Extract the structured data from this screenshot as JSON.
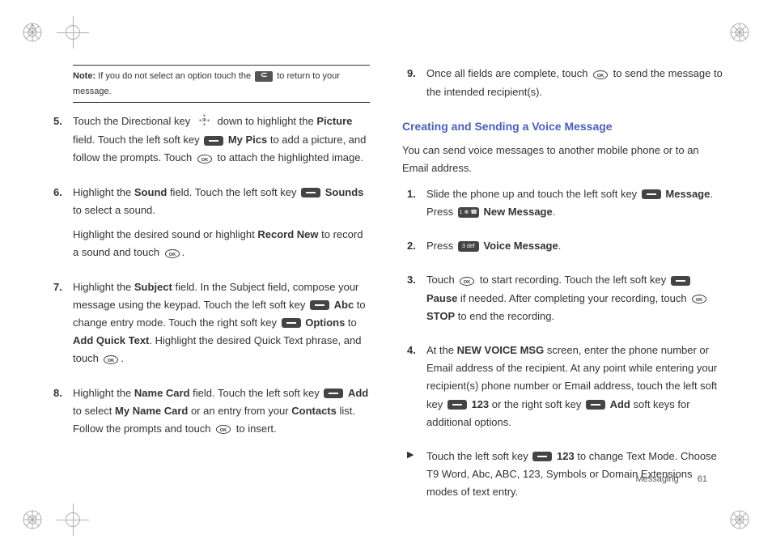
{
  "note": {
    "label": "Note:",
    "text_before": " If you do not select an option touch the ",
    "text_after": " to return to your message."
  },
  "left_steps": [
    {
      "num": "5.",
      "paragraphs": [
        {
          "fragments": [
            {
              "t": "Touch the Directional key "
            },
            {
              "icon": "dirkey"
            },
            {
              "t": " down to highlight the "
            },
            {
              "b": "Picture"
            },
            {
              "t": " field. Touch the left soft key "
            },
            {
              "icon": "softkey"
            },
            {
              "t": " "
            },
            {
              "b": "My Pics"
            },
            {
              "t": " to add a picture, and follow the prompts. Touch "
            },
            {
              "icon": "ok"
            },
            {
              "t": " to attach the highlighted image."
            }
          ]
        }
      ]
    },
    {
      "num": "6.",
      "paragraphs": [
        {
          "fragments": [
            {
              "t": "Highlight the "
            },
            {
              "b": "Sound"
            },
            {
              "t": " field. Touch the left soft key "
            },
            {
              "icon": "softkey"
            },
            {
              "t": " "
            },
            {
              "b": "Sounds"
            },
            {
              "t": " to select a sound."
            }
          ]
        },
        {
          "fragments": [
            {
              "t": "Highlight the desired sound or highlight "
            },
            {
              "b": "Record New"
            },
            {
              "t": " to record a sound and touch "
            },
            {
              "icon": "ok"
            },
            {
              "t": "."
            }
          ]
        }
      ]
    },
    {
      "num": "7.",
      "paragraphs": [
        {
          "fragments": [
            {
              "t": "Highlight the "
            },
            {
              "b": "Subject"
            },
            {
              "t": " field. In the Subject field, compose your message using the keypad. Touch the left soft key "
            },
            {
              "icon": "softkey"
            },
            {
              "t": " "
            },
            {
              "b": "Abc"
            },
            {
              "t": " to change entry mode. Touch the right soft key "
            },
            {
              "icon": "softkey"
            },
            {
              "t": " "
            },
            {
              "b": "Options"
            },
            {
              "t": " to "
            },
            {
              "b": "Add Quick Text"
            },
            {
              "t": ". Highlight the desired Quick Text phrase, and touch "
            },
            {
              "icon": "ok"
            },
            {
              "t": "."
            }
          ]
        }
      ]
    },
    {
      "num": "8.",
      "paragraphs": [
        {
          "fragments": [
            {
              "t": "Highlight the "
            },
            {
              "b": "Name Card"
            },
            {
              "t": " field. Touch the left soft key "
            },
            {
              "icon": "softkey"
            },
            {
              "t": " "
            },
            {
              "b": "Add"
            },
            {
              "t": " to select "
            },
            {
              "b": "My Name Card"
            },
            {
              "t": " or an entry from your "
            },
            {
              "b": "Contacts"
            },
            {
              "t": " list. Follow the prompts and touch "
            },
            {
              "icon": "ok"
            },
            {
              "t": " to insert."
            }
          ]
        }
      ]
    }
  ],
  "right_top_step": {
    "num": "9.",
    "paragraphs": [
      {
        "fragments": [
          {
            "t": "Once all fields are complete, touch "
          },
          {
            "icon": "ok"
          },
          {
            "t": " to send the message to the intended recipient(s)."
          }
        ]
      }
    ]
  },
  "heading": "Creating and Sending a Voice Message",
  "intro": "You can send voice messages to another mobile phone or to an Email address.",
  "right_steps": [
    {
      "num": "1.",
      "paragraphs": [
        {
          "fragments": [
            {
              "t": "Slide the phone up and touch the left soft key "
            },
            {
              "icon": "softkey"
            },
            {
              "t": " "
            },
            {
              "b": "Message"
            },
            {
              "t": ". Press "
            },
            {
              "icon": "numkey1"
            },
            {
              "t": " "
            },
            {
              "b": "New Message"
            },
            {
              "t": "."
            }
          ]
        }
      ]
    },
    {
      "num": "2.",
      "paragraphs": [
        {
          "fragments": [
            {
              "t": "Press "
            },
            {
              "icon": "numkey3"
            },
            {
              "t": " "
            },
            {
              "b": "Voice Message"
            },
            {
              "t": "."
            }
          ]
        }
      ]
    },
    {
      "num": "3.",
      "paragraphs": [
        {
          "fragments": [
            {
              "t": "Touch "
            },
            {
              "icon": "ok"
            },
            {
              "t": " to start recording. Touch the left soft key "
            },
            {
              "icon": "softkey"
            },
            {
              "t": " "
            },
            {
              "b": "Pause"
            },
            {
              "t": " if needed. After completing your recording, touch "
            },
            {
              "icon": "ok"
            },
            {
              "t": " "
            },
            {
              "b": "STOP"
            },
            {
              "t": " to end the recording."
            }
          ]
        }
      ]
    },
    {
      "num": "4.",
      "paragraphs": [
        {
          "fragments": [
            {
              "t": "At the "
            },
            {
              "b": "NEW VOICE MSG"
            },
            {
              "t": " screen, enter the phone number or Email address of the recipient. At any point while entering your recipient(s) phone number or Email address, touch the left soft key "
            },
            {
              "icon": "softkey"
            },
            {
              "t": " "
            },
            {
              "b": "123"
            },
            {
              "t": " or the right soft key "
            },
            {
              "icon": "softkey"
            },
            {
              "t": " "
            },
            {
              "b": "Add"
            },
            {
              "t": " soft keys for additional options."
            }
          ]
        }
      ]
    }
  ],
  "bullet": {
    "fragments": [
      {
        "t": "Touch the left soft key "
      },
      {
        "icon": "softkey"
      },
      {
        "t": " "
      },
      {
        "b": "123"
      },
      {
        "t": " to change Text Mode. Choose T9 Word, Abc, ABC, 123, Symbols or Domain Extensions modes of text entry."
      }
    ]
  },
  "footer": {
    "section": "Messaging",
    "page": "61"
  },
  "numkey_labels": {
    "k1": "1 ⊕ ☎",
    "k3": "3 def"
  }
}
